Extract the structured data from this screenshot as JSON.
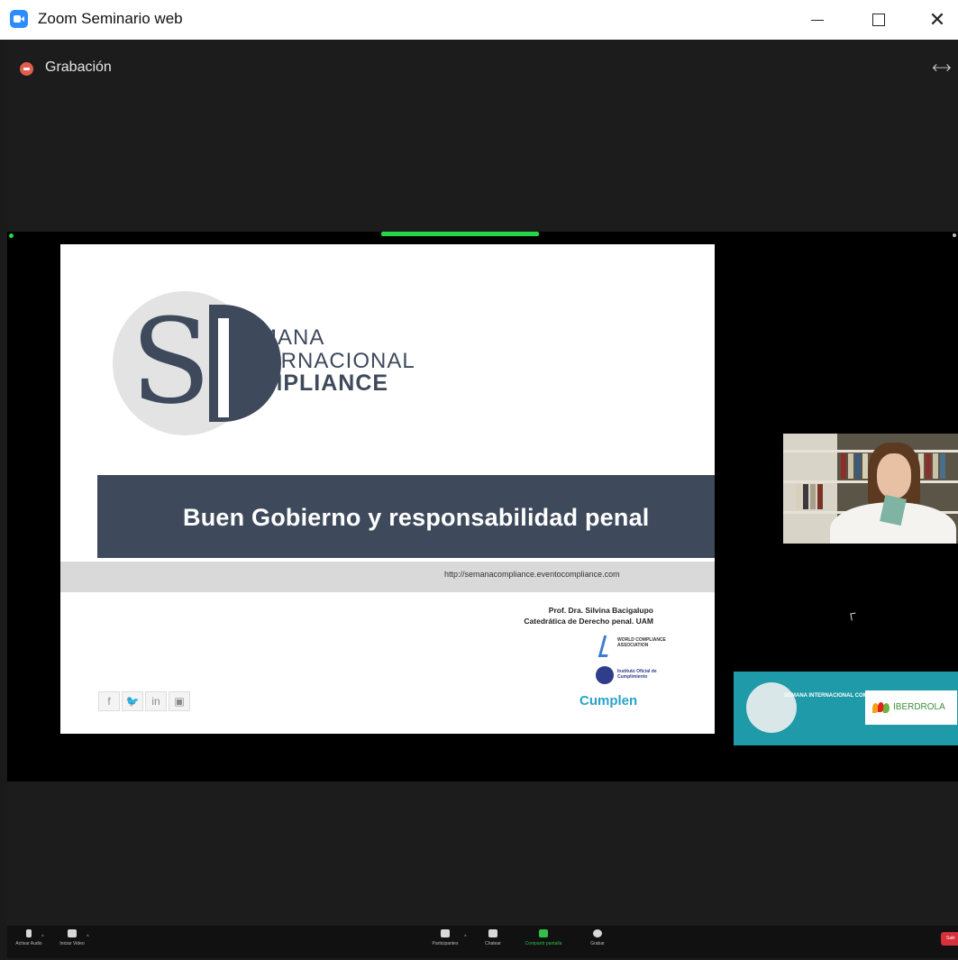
{
  "window": {
    "title": "Zoom Seminario web",
    "minimize_icon": "minimize-icon",
    "maximize_icon": "maximize-icon",
    "close_symbol": "✕"
  },
  "recording": {
    "label": "Grabación",
    "icon": "record-icon",
    "color": "#e35d4f"
  },
  "fullscreen": {
    "symbol": "⤢",
    "icon": "fullscreen-icon"
  },
  "share_indicator_color": "#24d64a",
  "slide": {
    "logo": {
      "line1": "SEMANA",
      "line2": "INTERNACIONAL",
      "line3": "COMPLIANCE"
    },
    "title": "Buen Gobierno y responsabilidad penal",
    "url": "http://semanacompliance.eventocompliance.com",
    "presenter_name": "Prof. Dra. Silvina  Bacigalupo",
    "presenter_role": "Catedrática de Derecho penal. UAM",
    "partner1": "WORLD COMPLIANCE ASSOCIATION",
    "partner2": "Instituto Oficial de Cumplimiento",
    "partner3": "Cumplen",
    "social": [
      "f",
      "🐦",
      "in",
      "▣"
    ],
    "band_color": "#3e4a5c"
  },
  "sponsor": {
    "event_text": "SEMANA INTERNACIONAL COMPLIANCE",
    "company": "IBERDROLA",
    "bg_color": "#1e9aa9"
  },
  "toolbar": {
    "unmute": "Activar Audio",
    "start_video": "Iniciar Video",
    "participants": "Participantes",
    "chat": "Chatear",
    "share": "Compartir pantalla",
    "record": "Grabar",
    "end": "Salir"
  }
}
